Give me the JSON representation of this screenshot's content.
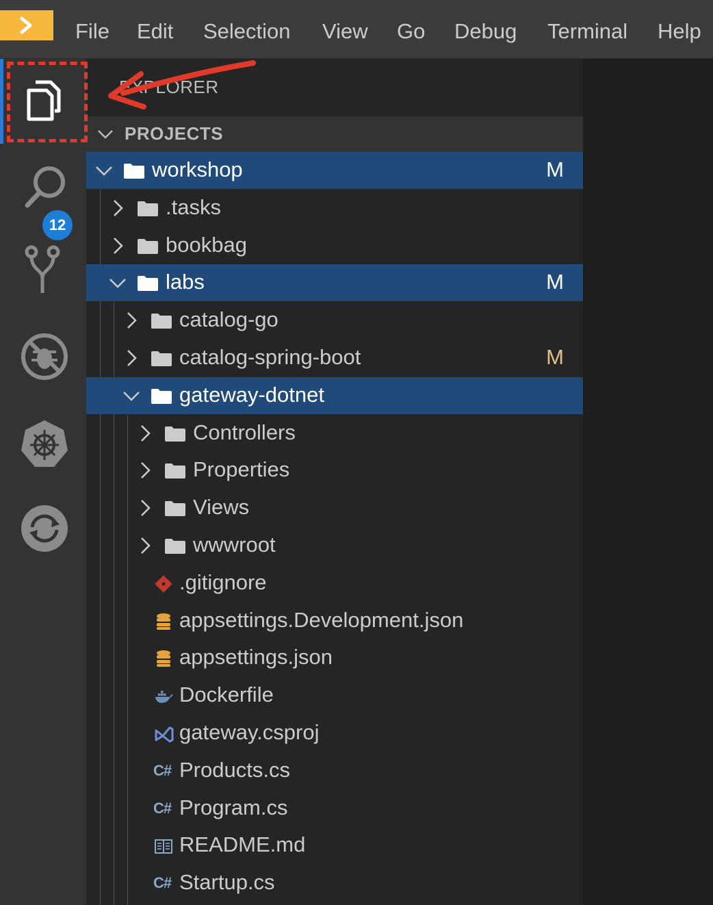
{
  "menu": {
    "items": [
      "File",
      "Edit",
      "Selection",
      "View",
      "Go",
      "Debug",
      "Terminal",
      "Help"
    ]
  },
  "activity_bar": {
    "items": [
      {
        "icon": "files-icon",
        "active": true
      },
      {
        "icon": "search-icon"
      },
      {
        "icon": "source-control-icon",
        "badge": "12"
      },
      {
        "icon": "debug-disabled-icon"
      },
      {
        "icon": "kubernetes-icon"
      },
      {
        "icon": "sync-icon"
      }
    ]
  },
  "explorer": {
    "title": "EXPLORER",
    "section": "PROJECTS"
  },
  "tree": [
    {
      "label": "workshop",
      "type": "folder",
      "expanded": true,
      "selected": true,
      "mark": "M",
      "mark_color": "#ffffff"
    },
    {
      "label": ".tasks",
      "type": "folder",
      "expanded": false
    },
    {
      "label": "bookbag",
      "type": "folder",
      "expanded": false
    },
    {
      "label": "labs",
      "type": "folder",
      "expanded": true,
      "selected": true,
      "mark": "M",
      "mark_color": "#ffffff"
    },
    {
      "label": "catalog-go",
      "type": "folder",
      "expanded": false
    },
    {
      "label": "catalog-spring-boot",
      "type": "folder",
      "expanded": false,
      "mark": "M",
      "mark_color": "#e2c08d"
    },
    {
      "label": "gateway-dotnet",
      "type": "folder",
      "expanded": true,
      "selected": true
    },
    {
      "label": "Controllers",
      "type": "folder",
      "expanded": false
    },
    {
      "label": "Properties",
      "type": "folder",
      "expanded": false
    },
    {
      "label": "Views",
      "type": "folder",
      "expanded": false
    },
    {
      "label": "wwwroot",
      "type": "folder",
      "expanded": false
    },
    {
      "label": ".gitignore",
      "type": "file",
      "icon": "git-icon"
    },
    {
      "label": "appsettings.Development.json",
      "type": "file",
      "icon": "json-database-icon"
    },
    {
      "label": "appsettings.json",
      "type": "file",
      "icon": "json-database-icon"
    },
    {
      "label": "Dockerfile",
      "type": "file",
      "icon": "docker-icon"
    },
    {
      "label": "gateway.csproj",
      "type": "file",
      "icon": "visual-studio-icon"
    },
    {
      "label": "Products.cs",
      "type": "file",
      "icon": "csharp-icon",
      "icon_text": "C#"
    },
    {
      "label": "Program.cs",
      "type": "file",
      "icon": "csharp-icon",
      "icon_text": "C#"
    },
    {
      "label": "README.md",
      "type": "file",
      "icon": "readme-book-icon"
    },
    {
      "label": "Startup.cs",
      "type": "file",
      "icon": "csharp-icon",
      "icon_text": "C#"
    }
  ],
  "colors": {
    "accent": "#f5b83d",
    "selection": "#1f4a7a",
    "modified": "#e2c08d",
    "annotation": "#e23a2a",
    "badge": "#1e7ed6"
  }
}
